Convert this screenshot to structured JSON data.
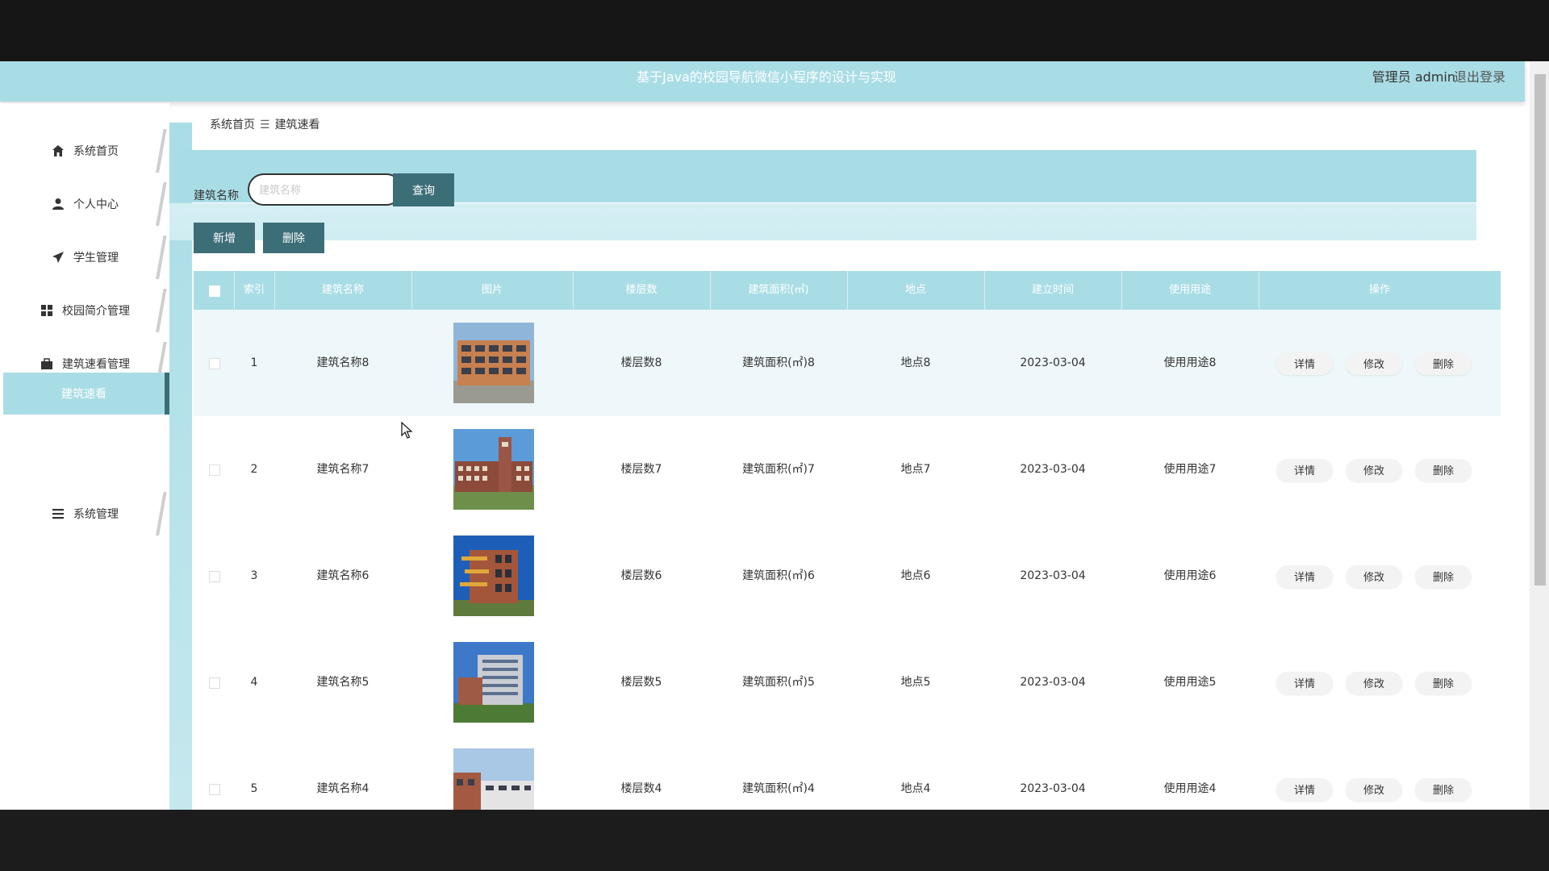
{
  "header": {
    "title": "基于Java的校园导航微信小程序的设计与实现",
    "user": "管理员 admin",
    "logout": "退出登录"
  },
  "sidebar": {
    "items": [
      {
        "label": "系统首页",
        "icon": "home-icon"
      },
      {
        "label": "个人中心",
        "icon": "user-icon"
      },
      {
        "label": "学生管理",
        "icon": "send-icon"
      },
      {
        "label": "校园简介管理",
        "icon": "grid-icon"
      },
      {
        "label": "建筑速看管理",
        "icon": "briefcase-icon"
      },
      {
        "label": "系统管理",
        "icon": "list-icon"
      }
    ],
    "active_sub": "建筑速看"
  },
  "breadcrumb": {
    "home": "系统首页",
    "current": "建筑速看"
  },
  "search": {
    "label": "建筑名称",
    "placeholder": "建筑名称",
    "query_button": "查询"
  },
  "toolbar": {
    "add_button": "新增",
    "delete_button": "删除"
  },
  "table": {
    "headers": [
      "索引",
      "建筑名称",
      "图片",
      "楼层数",
      "建筑面积(㎡)",
      "地点",
      "建立时间",
      "使用用途",
      "操作"
    ],
    "actions": {
      "detail": "详情",
      "edit": "修改",
      "delete": "删除"
    },
    "rows": [
      {
        "index": "1",
        "name": "建筑名称8",
        "floors": "楼层数8",
        "area": "建筑面积(㎡)8",
        "location": "地点8",
        "date": "2023-03-04",
        "usage": "使用用途8"
      },
      {
        "index": "2",
        "name": "建筑名称7",
        "floors": "楼层数7",
        "area": "建筑面积(㎡)7",
        "location": "地点7",
        "date": "2023-03-04",
        "usage": "使用用途7"
      },
      {
        "index": "3",
        "name": "建筑名称6",
        "floors": "楼层数6",
        "area": "建筑面积(㎡)6",
        "location": "地点6",
        "date": "2023-03-04",
        "usage": "使用用途6"
      },
      {
        "index": "4",
        "name": "建筑名称5",
        "floors": "楼层数5",
        "area": "建筑面积(㎡)5",
        "location": "地点5",
        "date": "2023-03-04",
        "usage": "使用用途5"
      },
      {
        "index": "5",
        "name": "建筑名称4",
        "floors": "楼层数4",
        "area": "建筑面积(㎡)4",
        "location": "地点4",
        "date": "2023-03-04",
        "usage": "使用用途4"
      }
    ]
  },
  "colors": {
    "header_bg": "#a9dde6",
    "button_bg": "#3c6e78",
    "row_alt": "#eef8fa"
  }
}
